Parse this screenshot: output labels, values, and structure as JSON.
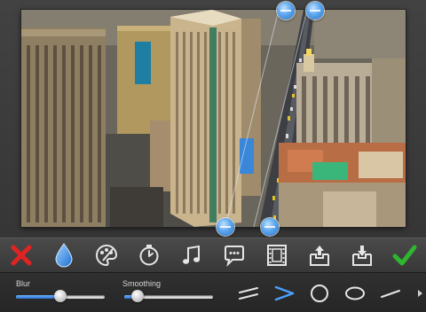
{
  "toolbar": {
    "tools": [
      {
        "name": "cancel",
        "icon": "close-icon",
        "color": "#e02424"
      },
      {
        "name": "blur",
        "icon": "water-drop-icon",
        "color": "#2f8fe6",
        "selected": true
      },
      {
        "name": "palette",
        "icon": "palette-icon"
      },
      {
        "name": "timer",
        "icon": "stopwatch-icon"
      },
      {
        "name": "music",
        "icon": "music-note-icon"
      },
      {
        "name": "comment",
        "icon": "speech-bubble-icon"
      },
      {
        "name": "film",
        "icon": "film-strip-icon"
      },
      {
        "name": "export",
        "icon": "box-upload-icon"
      },
      {
        "name": "import",
        "icon": "box-download-icon"
      },
      {
        "name": "confirm",
        "icon": "checkmark-icon",
        "color": "#2fb62f"
      }
    ]
  },
  "controls": {
    "blur": {
      "label": "Blur",
      "value": 0.5
    },
    "smoothing": {
      "label": "Smoothing",
      "value": 0.15
    },
    "shapes": [
      {
        "icon": "parallel-lines-icon"
      },
      {
        "icon": "chevron-right-icon",
        "selected": true
      },
      {
        "icon": "circle-icon"
      },
      {
        "icon": "ellipse-icon"
      },
      {
        "icon": "line-icon"
      }
    ]
  },
  "colors": {
    "accent": "#3b8ff0",
    "background": "#3a3a3a"
  }
}
